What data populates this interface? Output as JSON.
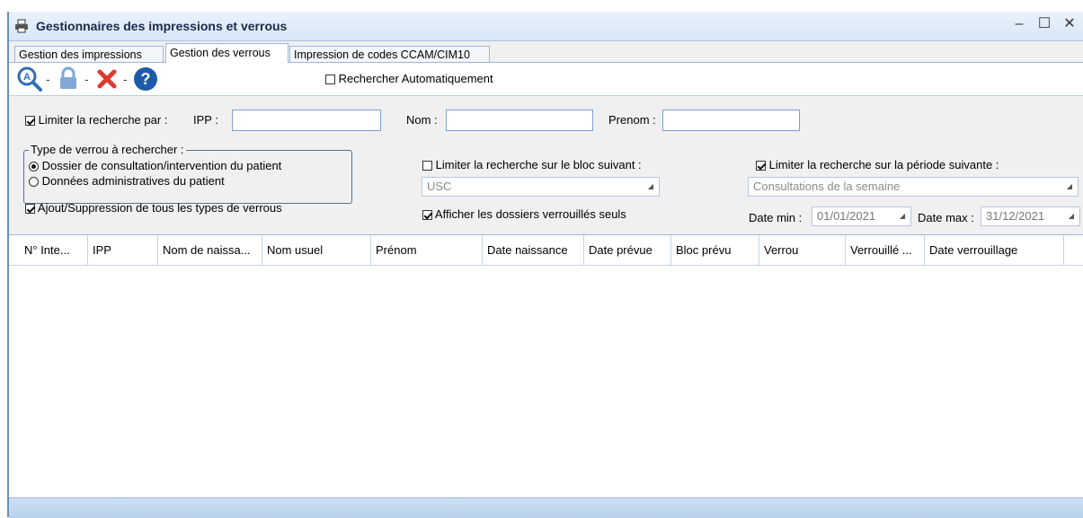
{
  "window": {
    "title": "Gestionnaires des impressions et verrous",
    "controls": {
      "minimize": "–",
      "maximize": "☐",
      "close": "✕"
    }
  },
  "tabs": [
    {
      "label": "Gestion des impressions",
      "active": false
    },
    {
      "label": "Gestion des verrous",
      "active": true
    },
    {
      "label": "Impression de codes CCAM/CIM10",
      "active": false
    }
  ],
  "toolbar": {
    "icons": [
      "search-icon",
      "lock-icon",
      "delete-icon",
      "help-icon"
    ],
    "separator": "-",
    "auto_search_label": "Rechercher Automatiquement",
    "auto_search_checked": false
  },
  "filters": {
    "limit_label": "Limiter la recherche par :",
    "limit_checked": true,
    "ipp_label": "IPP :",
    "ipp_value": "",
    "nom_label": "Nom :",
    "nom_value": "",
    "prenom_label": "Prenom :",
    "prenom_value": ""
  },
  "lock_type": {
    "legend": "Type de verrou à rechercher :",
    "options": [
      {
        "label": "Dossier de consultation/intervention du patient",
        "selected": true
      },
      {
        "label": "Données administratives du patient",
        "selected": false
      }
    ],
    "all_types_label": "Ajout/Suppression de tous les types de verrous",
    "all_types_checked": true
  },
  "bloc": {
    "label": "Limiter la recherche sur le bloc suivant :",
    "checked": false,
    "value": "USC",
    "locked_only_label": "Afficher les dossiers verrouillés seuls",
    "locked_only_checked": true
  },
  "periode": {
    "label": "Limiter la recherche sur la période suivante :",
    "checked": true,
    "value": "Consultations de la semaine",
    "date_min_label": "Date min :",
    "date_min": "01/01/2021",
    "date_max_label": "Date max :",
    "date_max": "31/12/2021"
  },
  "grid": {
    "columns": [
      "N° Inte...",
      "IPP",
      "Nom de naissa...",
      "Nom usuel",
      "Prénom",
      "Date naissance",
      "Date prévue",
      "Bloc prévu",
      "Verrou",
      "Verrouillé ...",
      "Date verrouillage"
    ],
    "rows": []
  },
  "colors": {
    "accent": "#2f6fb5",
    "delete": "#e03a2f",
    "help": "#1e5aa8"
  }
}
